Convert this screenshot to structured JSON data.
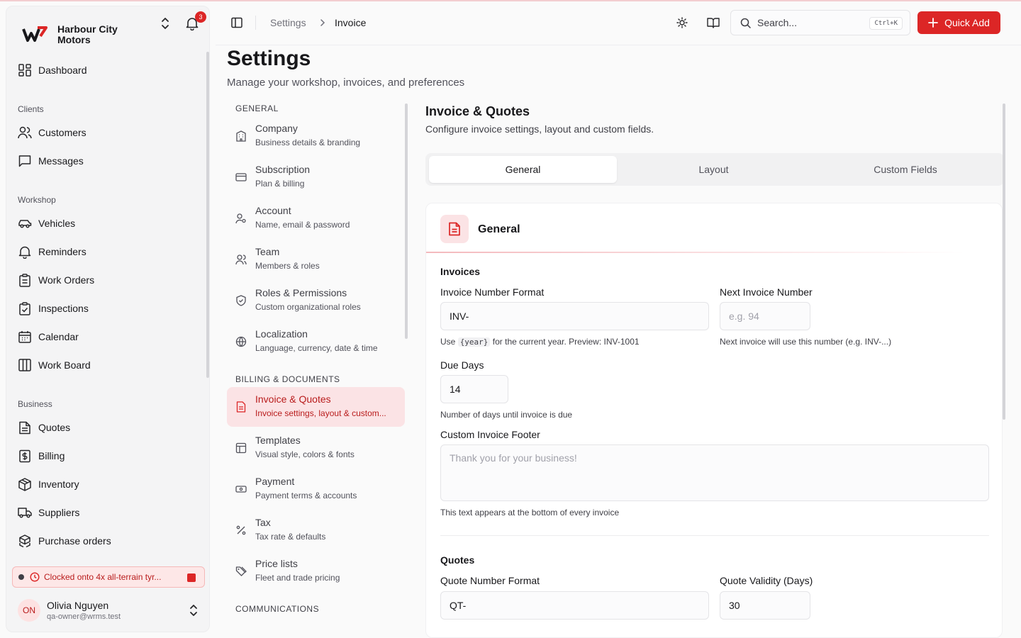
{
  "brand": {
    "name": "Harbour City Motors",
    "notification_count": "3"
  },
  "sidebar": {
    "top": [
      {
        "label": "Dashboard",
        "icon": "dashboard-icon"
      }
    ],
    "groups": [
      {
        "title": "Clients",
        "items": [
          {
            "label": "Customers",
            "icon": "users-icon"
          },
          {
            "label": "Messages",
            "icon": "message-icon"
          }
        ]
      },
      {
        "title": "Workshop",
        "items": [
          {
            "label": "Vehicles",
            "icon": "car-icon"
          },
          {
            "label": "Reminders",
            "icon": "bell-icon"
          },
          {
            "label": "Work Orders",
            "icon": "clipboard-icon"
          },
          {
            "label": "Inspections",
            "icon": "clipboard-check-icon"
          },
          {
            "label": "Calendar",
            "icon": "calendar-icon"
          },
          {
            "label": "Work Board",
            "icon": "columns-icon"
          }
        ]
      },
      {
        "title": "Business",
        "items": [
          {
            "label": "Quotes",
            "icon": "file-text-icon"
          },
          {
            "label": "Billing",
            "icon": "dollar-file-icon"
          },
          {
            "label": "Inventory",
            "icon": "package-icon"
          },
          {
            "label": "Suppliers",
            "icon": "truck-icon"
          },
          {
            "label": "Purchase orders",
            "icon": "boxes-icon"
          }
        ]
      }
    ],
    "clock_banner": "Clocked onto 4x all-terrain tyr...",
    "user": {
      "initials": "ON",
      "name": "Olivia Nguyen",
      "email": "qa-owner@wrms.test"
    }
  },
  "header": {
    "breadcrumb": [
      "Settings",
      "Invoice"
    ],
    "search_placeholder": "Search...",
    "search_shortcut": "Ctrl+K",
    "quick_add": "Quick Add"
  },
  "page": {
    "title": "Settings",
    "subtitle": "Manage your workshop, invoices, and preferences"
  },
  "settings_nav": {
    "groups": [
      {
        "title": "GENERAL",
        "items": [
          {
            "title": "Company",
            "desc": "Business details & branding",
            "icon": "building-icon"
          },
          {
            "title": "Subscription",
            "desc": "Plan & billing",
            "icon": "credit-card-icon"
          },
          {
            "title": "Account",
            "desc": "Name, email & password",
            "icon": "user-key-icon"
          },
          {
            "title": "Team",
            "desc": "Members & roles",
            "icon": "users-icon"
          },
          {
            "title": "Roles & Permissions",
            "desc": "Custom organizational roles",
            "icon": "shield-icon"
          },
          {
            "title": "Localization",
            "desc": "Language, currency, date & time",
            "icon": "globe-icon"
          }
        ]
      },
      {
        "title": "BILLING & DOCUMENTS",
        "items": [
          {
            "title": "Invoice & Quotes",
            "desc": "Invoice settings, layout & custom...",
            "icon": "file-text-icon",
            "active": true
          },
          {
            "title": "Templates",
            "desc": "Visual style, colors & fonts",
            "icon": "layout-icon"
          },
          {
            "title": "Payment",
            "desc": "Payment terms & accounts",
            "icon": "banknote-icon"
          },
          {
            "title": "Tax",
            "desc": "Tax rate & defaults",
            "icon": "percent-icon"
          },
          {
            "title": "Price lists",
            "desc": "Fleet and trade pricing",
            "icon": "tags-icon"
          }
        ]
      },
      {
        "title": "COMMUNICATIONS",
        "items": []
      }
    ]
  },
  "section": {
    "title": "Invoice & Quotes",
    "desc": "Configure invoice settings, layout and custom fields.",
    "tabs": [
      "General",
      "Layout",
      "Custom Fields"
    ],
    "active_tab": "General"
  },
  "card": {
    "title": "General",
    "invoices": {
      "heading": "Invoices",
      "number_format_label": "Invoice Number Format",
      "number_format_value": "INV-",
      "number_format_help_prefix": "Use",
      "number_format_help_code": "{year}",
      "number_format_help_suffix": "for the current year. Preview: INV-1001",
      "next_number_label": "Next Invoice Number",
      "next_number_placeholder": "e.g. 94",
      "next_number_help": "Next invoice will use this number (e.g. INV-...)",
      "due_days_label": "Due Days",
      "due_days_value": "14",
      "due_days_help": "Number of days until invoice is due",
      "footer_label": "Custom Invoice Footer",
      "footer_placeholder": "Thank you for your business!",
      "footer_help": "This text appears at the bottom of every invoice"
    },
    "quotes": {
      "heading": "Quotes",
      "number_format_label": "Quote Number Format",
      "number_format_value": "QT-",
      "validity_label": "Quote Validity (Days)",
      "validity_value": "30"
    }
  },
  "colors": {
    "accent": "#dc2626",
    "accent_soft": "#fbe3e5"
  }
}
